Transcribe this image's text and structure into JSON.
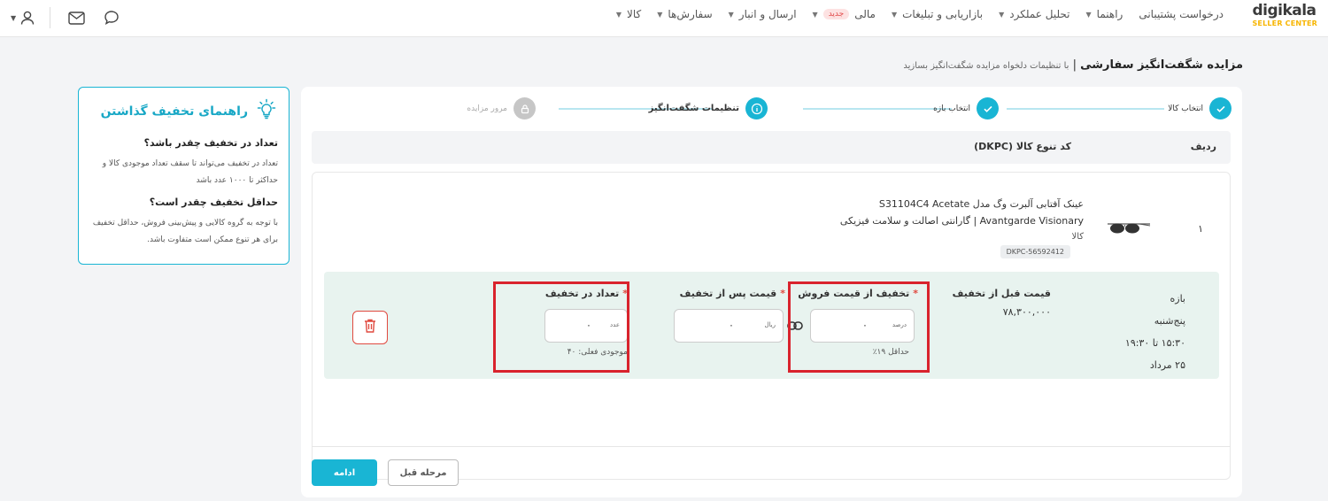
{
  "brand": {
    "logo_text": "digikala",
    "logo_sub": "SELLER CENTER"
  },
  "nav": {
    "items": [
      {
        "label": "کالا",
        "has_menu": true
      },
      {
        "label": "سفارش‌ها",
        "has_menu": true
      },
      {
        "label": "ارسال و انبار",
        "has_menu": true
      },
      {
        "label": "مالی",
        "has_menu": true,
        "badge": "جدید"
      },
      {
        "label": "بازاریابی و تبلیغات",
        "has_menu": true
      },
      {
        "label": "تحلیل عملکرد",
        "has_menu": true
      },
      {
        "label": "راهنما",
        "has_menu": true
      },
      {
        "label": "درخواست پشتیبانی",
        "has_menu": false
      }
    ],
    "icons": [
      "chat-icon",
      "mail-icon",
      "user-icon"
    ]
  },
  "page": {
    "title": "مزایده شگفت‌انگیز سفارشی",
    "separator": " | ",
    "subtitle": "با تنظیمات دلخواه مزایده شگفت‌انگیز بسازید"
  },
  "guide": {
    "title": "راهنمای تخفیف گذاشتن",
    "q1": "تعداد در تخفیف چقدر باشد؟",
    "a1": "تعداد در تخفیف می‌تواند تا سقف تعداد موجودی کالا و حداکثر تا ۱۰۰۰ عدد باشد",
    "q2": "حداقل تخفیف چقدر است؟",
    "a2": "با توجه به گروه کالایی و پیش‌بینی فروش، حداقل تخفیف برای هر تنوع ممکن است متفاوت باشد."
  },
  "stepper": {
    "steps": [
      {
        "label": "انتخاب کالا",
        "state": "done"
      },
      {
        "label": "انتخاب بازه",
        "state": "done"
      },
      {
        "label": "تنظیمات شگفت‌انگیز",
        "state": "current"
      },
      {
        "label": "مرور مزایده",
        "state": "locked"
      }
    ]
  },
  "table": {
    "col_row": "ردیف",
    "col_dkpc": "کد تنوع کالا (DKPC)"
  },
  "product": {
    "index": "۱",
    "name_line1": "عینک آفتابی آلبرت وگ مدل S31104C4 Acetate",
    "name_line2": "Avantgarde Visionary | گارانتی اصالت و سلامت فیزیکی",
    "category": "کالا",
    "dkpc": "DKPC-56592412"
  },
  "details": {
    "period_label": "بازه",
    "period_day": "پنج‌شنبه",
    "period_time": "۱۵:۳۰ تا ۱۹:۳۰",
    "period_date": "۲۵ مرداد",
    "price_before_label": "قیمت قبل از تخفیف",
    "price_before_value": "۷۸,۳۰۰,۰۰۰",
    "discount_label": "تخفیف از قیمت فروش",
    "discount_value": "۰",
    "discount_unit": "درصد",
    "discount_hint": "حداقل ۱۹٪",
    "price_after_label": "قیمت پس از تخفیف",
    "price_after_value": "۰",
    "price_after_unit": "ریال",
    "qty_label": "تعداد در تخفیف",
    "qty_value": "۰",
    "qty_unit": "عدد",
    "qty_hint": "موجودی فعلی: ۴۰",
    "required_mark": "*"
  },
  "actions": {
    "next_label": "ادامه",
    "prev_label": "مرحله قبل"
  },
  "colors": {
    "accent": "#19b5d4",
    "highlight_box": "#d9232d",
    "row_bg": "#e8f3ef",
    "danger": "#e0493f"
  }
}
